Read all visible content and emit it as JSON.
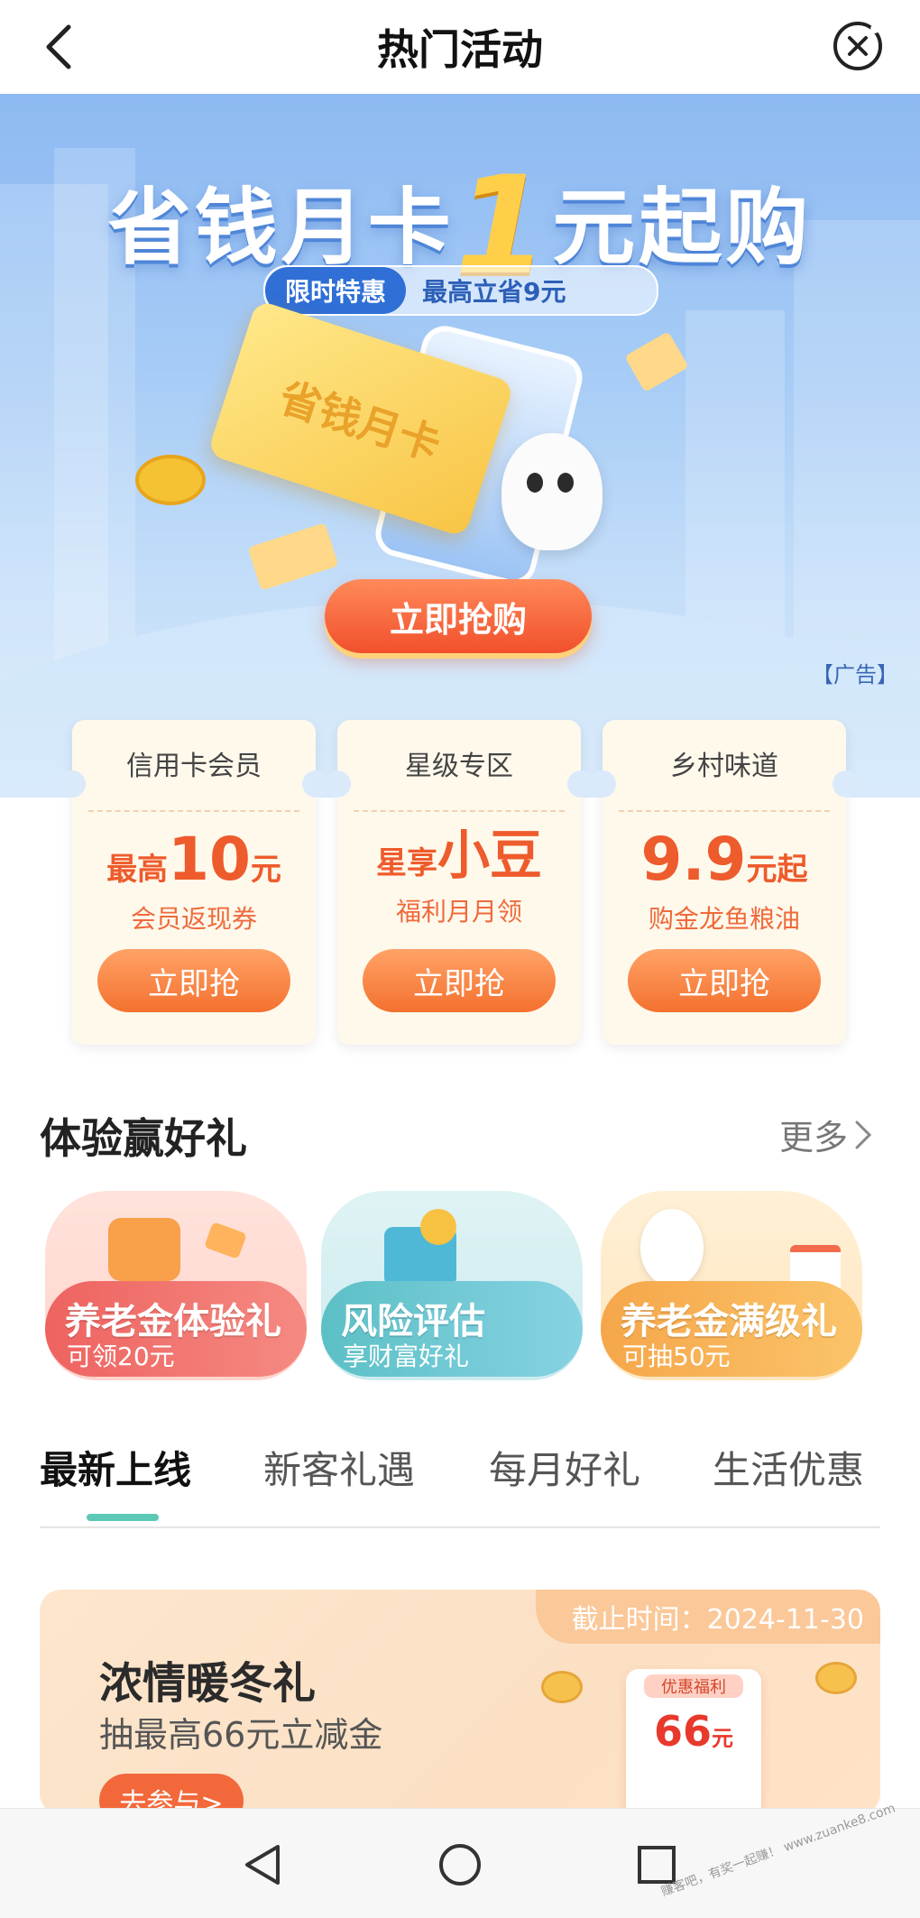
{
  "header": {
    "title": "热门活动",
    "back_icon": "chevron-left-icon",
    "close_icon": "close-circle-icon"
  },
  "hero": {
    "headline_pre": "省钱月卡",
    "headline_num": "1",
    "headline_post": "元起购",
    "tag": "限时特惠",
    "subtitle": "最高立省9元",
    "ticket_text": "省钱月卡",
    "button": "立即抢购",
    "ad_label": "【广告】"
  },
  "cards": [
    {
      "title": "信用卡会员",
      "prefix": "最高",
      "number": "10",
      "unit": "元",
      "desc": "会员返现券",
      "button": "立即抢"
    },
    {
      "title": "星级专区",
      "prefix": "星享",
      "number": "小豆",
      "unit": "",
      "desc": "福利月月领",
      "button": "立即抢"
    },
    {
      "title": "乡村味道",
      "prefix": "",
      "number": "9.9",
      "unit": "元起",
      "desc": "购金龙鱼粮油",
      "button": "立即抢"
    }
  ],
  "experience": {
    "title": "体验赢好礼",
    "more": "更多",
    "items": [
      {
        "name": "养老金体验礼",
        "sub": "可领20元",
        "color": "#ee6b6b"
      },
      {
        "name": "风险评估",
        "sub": "享财富好礼",
        "color": "#58b6c2"
      },
      {
        "name": "养老金满级礼",
        "sub": "可抽50元",
        "color": "#f7b250"
      }
    ]
  },
  "tabs": [
    "最新上线",
    "新客礼遇",
    "每月好礼",
    "生活优惠"
  ],
  "promo": {
    "deadline": "截止时间：2024-11-30",
    "title": "浓情暖冬礼",
    "subtitle": "抽最高66元立减金",
    "button": "去参与>",
    "coupon_tag": "优惠福利",
    "coupon_amount": "66",
    "coupon_unit": "元"
  },
  "watermark": "赚客吧，有奖一起赚！ www.zuanke8.com"
}
